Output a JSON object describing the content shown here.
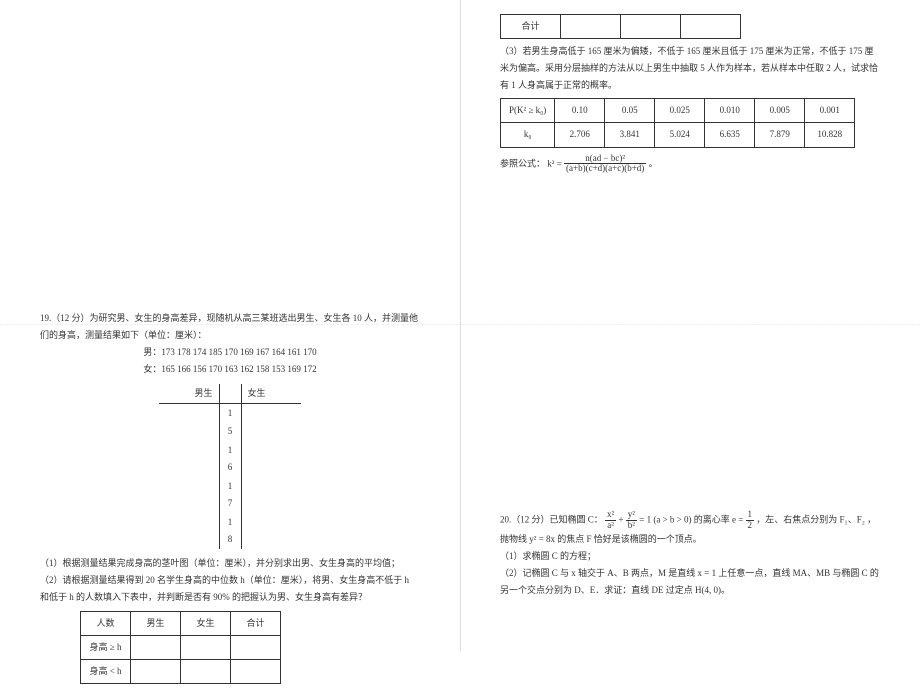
{
  "right_top": {
    "total_row_label": "合计",
    "q3_text": "（3）若男生身高低于 165 厘米为偏矮，不低于 165 厘米且低于 175 厘米为正常，不低于 175 厘米为偏高。采用分层抽样的方法从以上男生中抽取 5 人作为样本，若从样本中任取 2 人，试求恰有 1 人身高属于正常的概率。",
    "ptable": {
      "r1": [
        "P(K² ≥ k₀)",
        "0.10",
        "0.05",
        "0.025",
        "0.010",
        "0.005",
        "0.001"
      ],
      "r2": [
        "k₀",
        "2.706",
        "3.841",
        "5.024",
        "6.635",
        "7.879",
        "10.828"
      ]
    },
    "formula_label": "参照公式：",
    "formula_lhs": "k² = ",
    "formula_num": "n(ad − bc)²",
    "formula_den": "(a+b)(c+d)(a+c)(b+d)",
    "formula_tail": "。"
  },
  "q19": {
    "title": "19.（12 分）为研究男、女生的身高差异，现随机从高三某班选出男生、女生各 10 人，并测量他们的身高，测量结果如下（单位：厘米）：",
    "male_line": "男：173 178 174 185 170 169 167 164 161 170",
    "female_line": "女：165 166 156 170 163 162 158 153 169 172",
    "stem_leaf": {
      "hdr_left": "男生",
      "hdr_right": "女生",
      "rows": [
        {
          "s": "1 5"
        },
        {
          "s": "1 6"
        },
        {
          "s": "1 7"
        },
        {
          "s": "1 8"
        }
      ]
    },
    "p1": "（1）根据测量结果完成身高的茎叶图（单位：厘米），并分别求出男、女生身高的平均值；",
    "p2": "（2）请根据测量结果得到 20 名学生身高的中位数 h（单位：厘米），将男、女生身高不低于 h 和低于 h 的人数填入下表中，并判断是否有 90% 的把握认为男、女生身高有差异？",
    "table2": {
      "h": [
        "人数",
        "男生",
        "女生",
        "合计"
      ],
      "r1": "身高 ≥ h",
      "r2": "身高 < h"
    }
  },
  "q20": {
    "line1a": "20.（12 分）已知椭圆 C：",
    "frac1_num": "x²",
    "frac1_den": "a²",
    "plus": " + ",
    "frac2_num": "y²",
    "frac2_den": "b²",
    "line1b": " = 1 (a > b > 0) 的离心率 e = ",
    "frac3_num": "1",
    "frac3_den": "2",
    "line1c": " ，左、右焦点分别为 F₁、F₂ ，抛物线 y² = 8x 的焦点 F 恰好是该椭圆的一个顶点。",
    "p1": "（1）求椭圆 C 的方程；",
    "p2": "（2）记椭圆 C 与 x 轴交于 A、B 两点，M 是直线 x = 1 上任意一点，直线 MA、MB 与椭圆 C 的另一个交点分别为 D、E．求证：直线 DE 过定点 H(4, 0)。"
  }
}
